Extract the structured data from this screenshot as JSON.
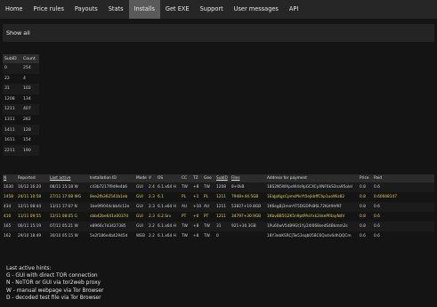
{
  "nav": {
    "items": [
      {
        "label": "Home",
        "active": false
      },
      {
        "label": "Price rules",
        "active": false
      },
      {
        "label": "Payouts",
        "active": false
      },
      {
        "label": "Stats",
        "active": false
      },
      {
        "label": "Installs",
        "active": true
      },
      {
        "label": "Get EXE",
        "active": false
      },
      {
        "label": "Support",
        "active": false
      },
      {
        "label": "User messages",
        "active": false
      },
      {
        "label": "API",
        "active": false
      }
    ]
  },
  "show_all_label": "Show all",
  "sub_table": {
    "headers": [
      "SubID",
      "Count"
    ],
    "rows": [
      [
        "0",
        "254"
      ],
      [
        "22",
        "4"
      ],
      [
        "31",
        "102"
      ],
      [
        "1208",
        "134"
      ],
      [
        "1211",
        "407"
      ],
      [
        "1311",
        "282"
      ],
      [
        "1411",
        "128"
      ],
      [
        "1611",
        "154"
      ],
      [
        "2211",
        "190"
      ]
    ]
  },
  "installs": {
    "headers": [
      "N",
      "Reported",
      "Last active",
      "Installation ID",
      "Mode",
      "V",
      "OS",
      "CC",
      "TZ",
      "Geo",
      "SubID",
      "Files",
      "Address for payment",
      "Price",
      "Paid"
    ],
    "underlined": [
      true,
      false,
      true,
      false,
      false,
      false,
      false,
      false,
      false,
      false,
      true,
      true,
      false,
      false,
      false
    ],
    "rows": [
      {
        "highlight": false,
        "cells": [
          "1630",
          "16/12 16:20",
          "08/11 15:18 W",
          "c43b7217f9d9e4b6",
          "GUI",
          "2.4",
          "6.1.x64 H",
          "TW",
          "+8",
          "TW",
          "1208",
          "8+0kB",
          "18S2N5WXpsW4s9pGCXCyXNF6kS3na95olel",
          "0.8",
          "0.6"
        ]
      },
      {
        "highlight": true,
        "cells": [
          "1458",
          "24/11 10:58",
          "27/11 17:08 WG",
          "8ee2fb362541b1eb",
          "GUI",
          "2.3",
          "6.1",
          "PL",
          "+1",
          "PL",
          "1211",
          "7948+44.5GB",
          "1EaJpKgcCpmsMvYt5ejkbffChp1uoWiz82",
          "0.8",
          "0.60048147"
        ]
      },
      {
        "highlight": false,
        "cells": [
          "434",
          "12/11 08:44",
          "13/11 17:07 N",
          "1be9f0044cbb4c12e",
          "GUI",
          "2.3",
          "6.1.x64 H",
          "AU",
          "+10",
          "AU",
          "1211",
          "53827+19.8GB",
          "1K6egBj3mmYF5DGDPsB6L72Kzt9hfKF",
          "0.8",
          "0.6"
        ]
      },
      {
        "highlight": true,
        "cells": [
          "410",
          "11/11 09:55",
          "12/11 08:05 G",
          "cbb42be641a0037d",
          "GUI",
          "2.3",
          "6.2.Srv",
          "PT",
          "+0",
          "PT",
          "1211",
          "34797+30.9GB",
          "1KbvBB5G2K5n9ptPAsYxk2dsePf4ayNdV",
          "0.8",
          "0.6"
        ]
      },
      {
        "highlight": false,
        "cells": [
          "165",
          "06/11 15:19",
          "07/11 05:21 W",
          "e8966c7d3427385",
          "GUI",
          "2.2",
          "6.1.x64 H",
          "TW",
          "+8",
          "TW",
          "31",
          "921+30.3GB",
          "1Pu60wV5dB9Gt1Yy24l068sedS4Bkmm2s",
          "0.8",
          "0.6"
        ]
      },
      {
        "highlight": false,
        "cells": [
          "162",
          "29/10 18:49",
          "30/10 05:15 W",
          "5e2f186e4b42945d",
          "WEB",
          "2.2",
          "6.1.x64 H",
          "TW",
          "+8",
          "TW",
          "0",
          "",
          "18Y3ebKSRCjTw53sqb058C6Qx4v6dhQQCm",
          "0.6",
          "0.6"
        ]
      }
    ]
  },
  "hints": {
    "title": "Last active hints:",
    "lines": [
      "G - GUI with direct TOR connection",
      "N - NoTOR or GUI via tor2web proxy",
      "W - manual webpage via Tor Browser",
      "D - decoded test file via Tor Browser"
    ]
  }
}
